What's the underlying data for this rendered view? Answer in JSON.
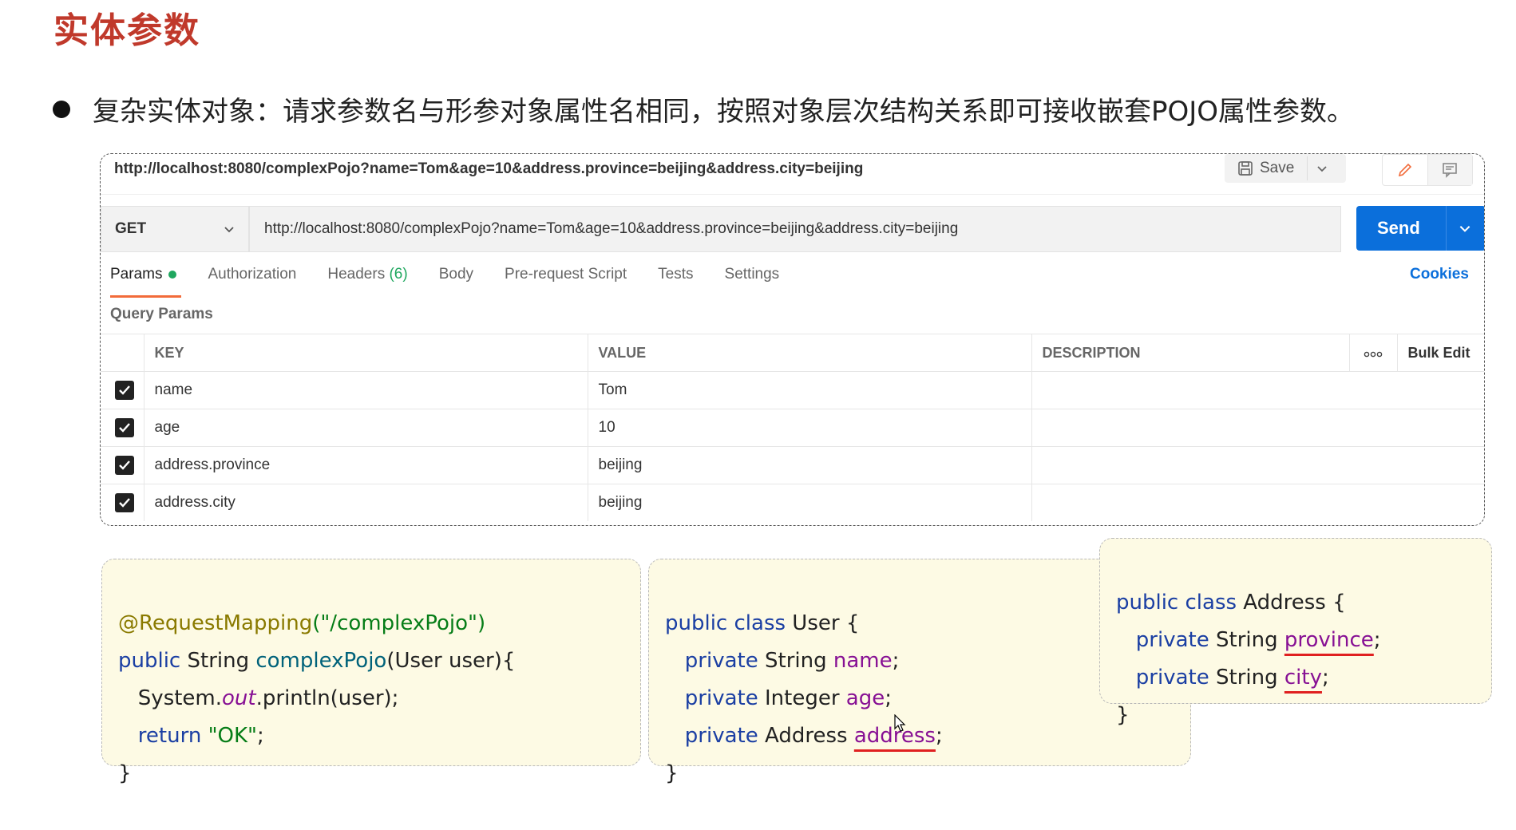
{
  "slide": {
    "title": "实体参数",
    "bullet": "复杂实体对象：请求参数名与形参对象属性名相同，按照对象层次结构关系即可接收嵌套POJO属性参数。"
  },
  "postman": {
    "request_title": "http://localhost:8080/complexPojo?name=Tom&age=10&address.province=beijing&address.city=beijing",
    "save_label": "Save",
    "method": "GET",
    "url": "http://localhost:8080/complexPojo?name=Tom&age=10&address.province=beijing&address.city=beijing",
    "send_label": "Send",
    "tabs": {
      "params": "Params",
      "authorization": "Authorization",
      "headers": "Headers",
      "headers_count": "(6)",
      "body": "Body",
      "prerequest": "Pre-request Script",
      "tests": "Tests",
      "settings": "Settings"
    },
    "cookies_label": "Cookies",
    "query_params_label": "Query Params",
    "columns": {
      "key": "KEY",
      "value": "VALUE",
      "description": "DESCRIPTION",
      "bulk_edit": "Bulk Edit"
    },
    "rows": [
      {
        "key": "name",
        "value": "Tom",
        "description": ""
      },
      {
        "key": "age",
        "value": "10",
        "description": ""
      },
      {
        "key": "address.province",
        "value": "beijing",
        "description": ""
      },
      {
        "key": "address.city",
        "value": "beijing",
        "description": ""
      }
    ]
  },
  "code": {
    "controller": {
      "annotation": "@RequestMapping",
      "path_literal": "(\"/complexPojo\")",
      "l2_kw": "public",
      "l2_type": " String ",
      "l2_fn": "complexPojo",
      "l2_rest": "(User user){",
      "l3_a": "System.",
      "l3_out": "out",
      "l3_b": ".println(user);",
      "l4_kw": "return",
      "l4_str": "\"OK\"",
      "l4_end": ";",
      "close": "}"
    },
    "user_class": {
      "header_kw": "public class",
      "header_name": " User {",
      "f1_kw": "private",
      "f1_type": " String ",
      "f1_name": "name",
      "f2_kw": "private",
      "f2_type": " Integer ",
      "f2_name": "age",
      "f3_kw": "private",
      "f3_type": " Address ",
      "f3_name": "address",
      "semi": ";",
      "close": "}"
    },
    "address_class": {
      "header_kw": "public class",
      "header_name": " Address {",
      "f1_kw": "private",
      "f1_type": " String ",
      "f1_name": "province",
      "f2_kw": "private",
      "f2_type": " String ",
      "f2_name": "city",
      "semi": ";",
      "close": "}"
    }
  },
  "colors": {
    "title_red": "#c0392b",
    "send_blue": "#0b6fdb",
    "active_tab_orange": "#f26b3a",
    "status_green": "#1fa75f",
    "code_bg": "#fdfae4"
  }
}
